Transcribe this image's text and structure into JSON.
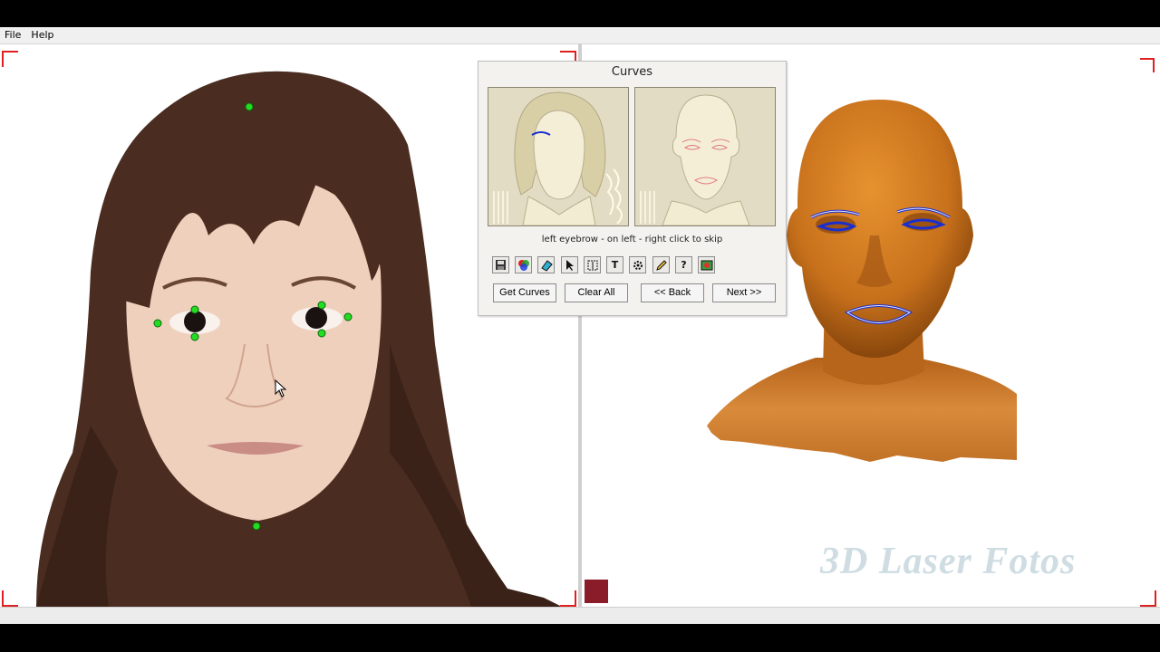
{
  "menu": {
    "file": "File",
    "help": "Help"
  },
  "dialog": {
    "title": "Curves",
    "hint": "left eyebrow - on left - right click to skip",
    "tools": [
      {
        "icon": "save-icon"
      },
      {
        "icon": "color-icon"
      },
      {
        "icon": "fill-icon"
      },
      {
        "icon": "pointer-icon"
      },
      {
        "icon": "select-region-icon"
      },
      {
        "icon": "text-icon",
        "glyph": "T"
      },
      {
        "icon": "settings-icon"
      },
      {
        "icon": "pencil-icon"
      },
      {
        "icon": "help-icon",
        "glyph": "?"
      },
      {
        "icon": "image-icon"
      }
    ],
    "buttons": {
      "get_curves": "Get Curves",
      "clear_all": "Clear All",
      "back": "<< Back",
      "next": "Next >>"
    }
  },
  "watermark": "3D Laser Fotos",
  "colors": {
    "landmark": "#22dd22",
    "curve": "#1a2fd0",
    "skin3d": "#c8711c",
    "crop_mark": "#e02020"
  }
}
